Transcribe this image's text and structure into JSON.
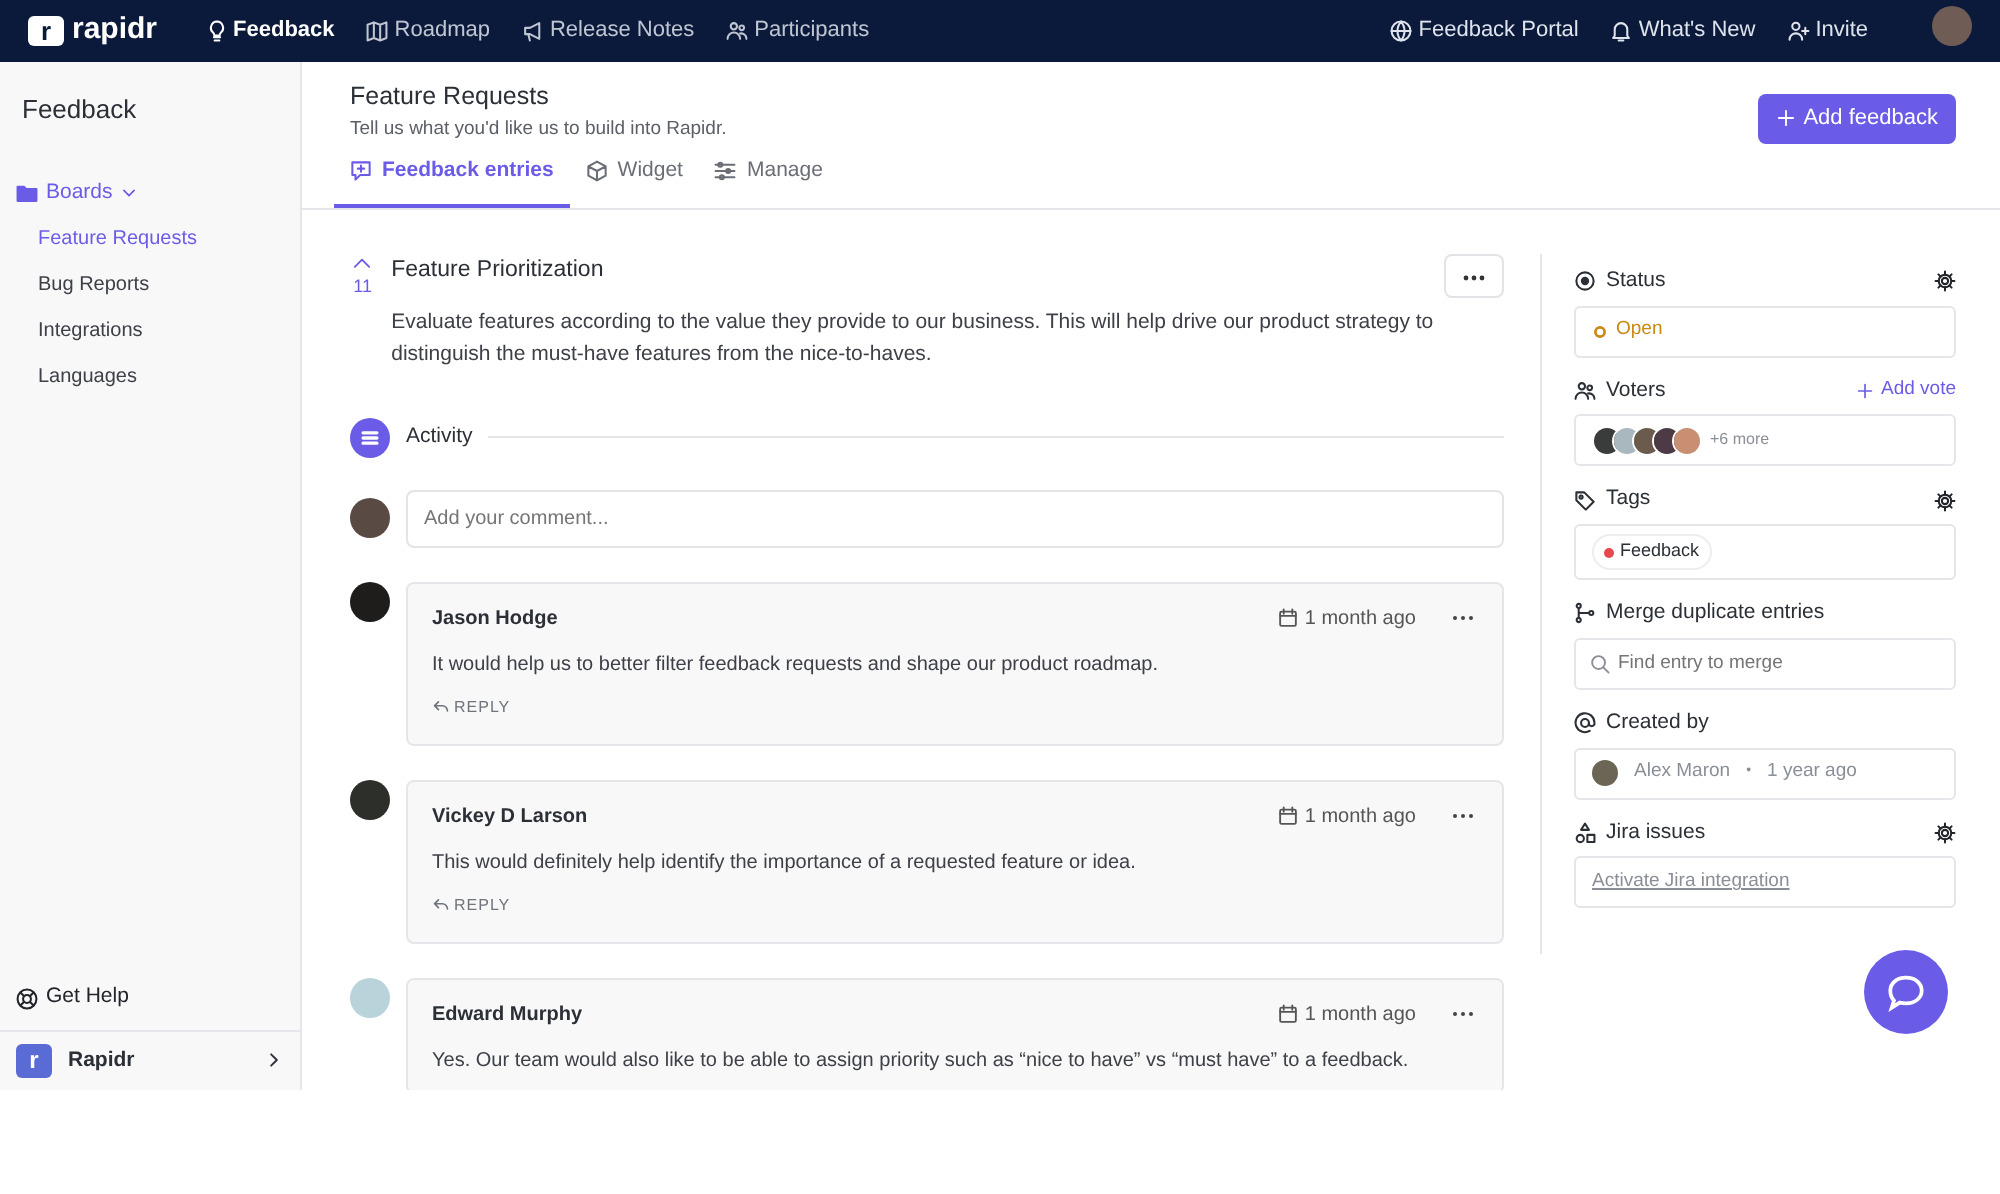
{
  "nav": {
    "logo_mark": "r",
    "logo_text": "rapidr",
    "links": [
      {
        "label": "Feedback",
        "selected": true
      },
      {
        "label": "Roadmap",
        "selected": false
      },
      {
        "label": "Release Notes",
        "selected": false
      },
      {
        "label": "Participants",
        "selected": false
      }
    ],
    "right_links": [
      {
        "label": "Feedback Portal"
      },
      {
        "label": "What's New"
      },
      {
        "label": "Invite"
      }
    ]
  },
  "sidebar": {
    "title": "Feedback",
    "boards": {
      "label": "Boards",
      "expanded": true,
      "items": [
        {
          "label": "Feature Requests",
          "selected": true
        },
        {
          "label": "Bug Reports",
          "selected": false
        },
        {
          "label": "Integrations",
          "selected": false
        },
        {
          "label": "Languages",
          "selected": false
        }
      ]
    },
    "get_help": "Get Help",
    "workspace": {
      "mark": "r",
      "name": "Rapidr"
    }
  },
  "header": {
    "title": "Feature Requests",
    "subtitle": "Tell us what you'd like us to build into Rapidr.",
    "add_button": "Add feedback",
    "tabs": [
      {
        "label": "Feedback entries",
        "selected": true
      },
      {
        "label": "Widget",
        "selected": false
      },
      {
        "label": "Manage",
        "selected": false
      }
    ]
  },
  "post": {
    "votes": "11",
    "title": "Feature Prioritization",
    "description": "Evaluate features according to the value they provide to our business. This will help drive our product strategy to distinguish the must-have features from the nice-to-haves."
  },
  "activity": {
    "label": "Activity",
    "comment_placeholder": "Add your comment..."
  },
  "comments": [
    {
      "author": "Jason Hodge",
      "time": "1 month ago",
      "text": "It would help us to better filter feedback requests and shape our product roadmap.",
      "reply": "REPLY"
    },
    {
      "author": "Vickey D Larson",
      "time": "1 month ago",
      "text": "This would definitely help identify the importance of a requested feature or idea.",
      "reply": "REPLY"
    },
    {
      "author": "Edward Murphy",
      "time": "1 month ago",
      "text": "Yes. Our team would also like to be able to assign priority such as “nice to have” vs “must have” to a feedback."
    }
  ],
  "details": [
    {
      "kind": "status",
      "label": "Status",
      "settings": true,
      "value": "Open",
      "color": "#c98a14"
    },
    {
      "kind": "voters",
      "label": "Voters",
      "action": "Add vote",
      "more": "+6 more"
    },
    {
      "kind": "tags",
      "label": "Tags",
      "settings": true,
      "tags": [
        {
          "label": "Feedback",
          "color": "#e5484d"
        }
      ]
    },
    {
      "kind": "search",
      "label": "Merge duplicate entries",
      "placeholder": "Find entry to merge"
    },
    {
      "kind": "creator",
      "label": "Created by",
      "name": "Alex Maron",
      "separator": "•",
      "time": "1 year ago"
    },
    {
      "kind": "link",
      "label": "Jira issues",
      "settings": true,
      "link": "Activate Jira integration"
    }
  ]
}
